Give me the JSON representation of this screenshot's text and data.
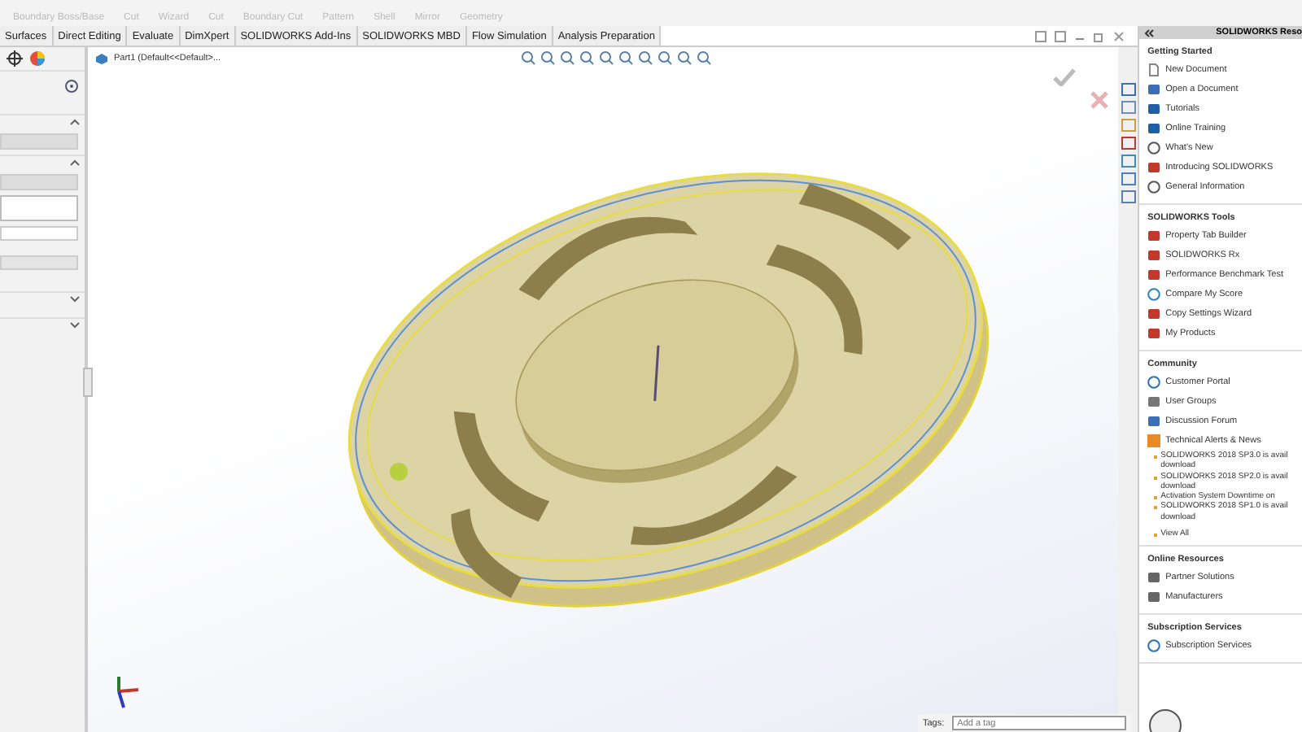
{
  "ribbon": {
    "commands": [
      "Boundary Boss/Base",
      "Cut",
      "Wizard",
      "Cut",
      "Boundary Cut",
      "Pattern",
      "Shell",
      "Mirror",
      "Geometry"
    ]
  },
  "tabs": [
    {
      "label": "Surfaces",
      "selected": false
    },
    {
      "label": "Direct Editing",
      "selected": false
    },
    {
      "label": "Evaluate",
      "selected": false
    },
    {
      "label": "DimXpert",
      "selected": false
    },
    {
      "label": "SOLIDWORKS Add-Ins",
      "selected": false
    },
    {
      "label": "SOLIDWORKS MBD",
      "selected": false
    },
    {
      "label": "Flow Simulation",
      "selected": false
    },
    {
      "label": "Analysis Preparation",
      "selected": false
    }
  ],
  "viewport": {
    "tree_item": "Part1  (Default<<Default>...",
    "tags_label": "Tags:",
    "tags_placeholder": "Add a tag"
  },
  "resources": {
    "title": "SOLIDWORKS Reso",
    "sections": [
      {
        "title": "Getting Started",
        "items": [
          {
            "label": "New Document"
          },
          {
            "label": "Open a Document"
          },
          {
            "label": "Tutorials"
          },
          {
            "label": "Online Training"
          },
          {
            "label": "What's New"
          },
          {
            "label": "Introducing SOLIDWORKS"
          },
          {
            "label": "General Information"
          }
        ]
      },
      {
        "title": "SOLIDWORKS Tools",
        "items": [
          {
            "label": "Property Tab Builder"
          },
          {
            "label": "SOLIDWORKS Rx"
          },
          {
            "label": "Performance Benchmark Test"
          },
          {
            "label": "Compare My Score"
          },
          {
            "label": "Copy Settings Wizard"
          },
          {
            "label": "My Products"
          }
        ]
      },
      {
        "title": "Community",
        "items": [
          {
            "label": "Customer Portal"
          },
          {
            "label": "User Groups"
          },
          {
            "label": "Discussion Forum"
          },
          {
            "label": "Technical Alerts & News"
          }
        ],
        "news": [
          {
            "lines": [
              "SOLIDWORKS 2018 SP3.0 is avail",
              "download"
            ]
          },
          {
            "lines": [
              "SOLIDWORKS 2018 SP2.0 is avail",
              "download"
            ]
          },
          {
            "lines": [
              "Activation System Downtime on"
            ]
          },
          {
            "lines": [
              "SOLIDWORKS 2018 SP1.0 is avail",
              "download"
            ]
          }
        ],
        "more": "View All"
      },
      {
        "title": "Online Resources",
        "items": [
          {
            "label": "Partner Solutions"
          },
          {
            "label": "Manufacturers"
          }
        ]
      },
      {
        "title": "Subscription Services",
        "items": [
          {
            "label": "Subscription Services"
          }
        ]
      }
    ]
  }
}
